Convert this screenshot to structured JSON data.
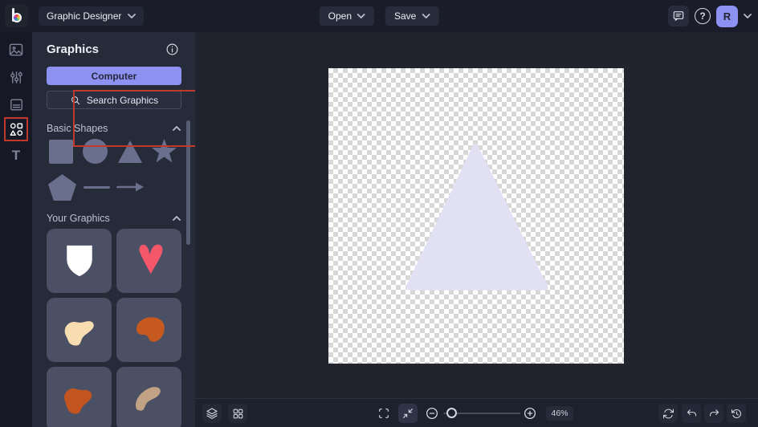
{
  "colors": {
    "accent": "#8d92f2",
    "annotation": "#c0392b",
    "topbar-bg": "#1a1d29",
    "strip-bg": "#161925",
    "panel-bg": "#262b3a",
    "canvas-bg": "#21242f",
    "bottombar-bg": "#1d212d",
    "button-bg": "#272c3c",
    "tile-bg": "#4b5064",
    "shape-fill": "#6a6f8e",
    "triangle-fill": "#e2e1f4",
    "checker": "#d7d7d7",
    "text-primary": "#eceef4",
    "text-muted": "#bdc1d1",
    "avatar-text": "#20242f",
    "heart": "#f4566a",
    "cream": "#f8ddb0",
    "orange": "#c65a1e",
    "orange2": "#c2551f",
    "tan": "#c2a284",
    "shield": "#ffffff"
  },
  "topbar": {
    "app_menu_label": "Graphic Designer",
    "open_label": "Open",
    "save_label": "Save",
    "avatar_initial": "R"
  },
  "icons": {
    "text_tool": "T",
    "help_glyph": "?"
  },
  "panel": {
    "title": "Graphics",
    "computer_button_label": "Computer",
    "search_button_label": "Search Graphics",
    "sections": {
      "basic_shapes": {
        "label": "Basic Shapes",
        "items": [
          "square",
          "circle",
          "triangle",
          "star",
          "pentagon",
          "line",
          "arrow"
        ]
      },
      "your_graphics": {
        "label": "Your Graphics",
        "items": [
          "shield",
          "heart",
          "cream-blob",
          "orange-bean",
          "orange-blob",
          "tan-bean"
        ]
      }
    }
  },
  "bottombar": {
    "zoom_label": "46%"
  }
}
